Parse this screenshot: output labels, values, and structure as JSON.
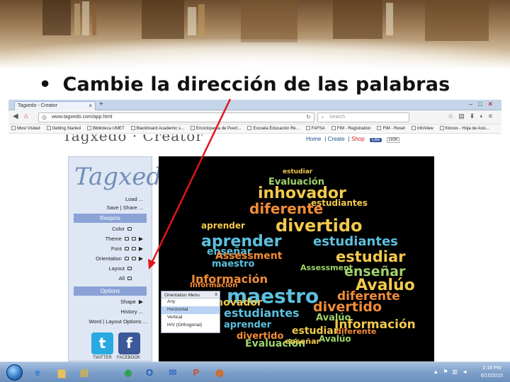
{
  "slide": {
    "bullet": "•",
    "title": "Cambie la dirección de las palabras"
  },
  "browser": {
    "tab_title": "Tagxedo - Creator",
    "new_tab": "+",
    "url": "www.tagxedo.com/app.html",
    "search_placeholder": "Search",
    "bookmarks": [
      "Most Visited",
      "Getting Started",
      "Biblioteca UMET",
      "Blackboard Academic s...",
      "Enciclopedia de Puert...",
      "Escuela Educación Re...",
      "FAFSA",
      "FIM - Registration",
      "FIM - Reset",
      "InfoView",
      "Klonos - Hoja de Asis..."
    ]
  },
  "site": {
    "title": "Tagxedo · Creator",
    "nav": [
      "Home",
      "Create",
      "Shop"
    ],
    "facebook_label": "Like",
    "facebook_count": "183K"
  },
  "panel": {
    "logo": "Tagxedo",
    "load": "Load ...",
    "save_share": "Save | Share ...",
    "respins_header": "Respins",
    "color": "Color",
    "theme": "Theme",
    "font": "Font",
    "orientation": "Orientation",
    "layout": "Layout",
    "all": "All",
    "options_header": "Options",
    "shape": "Shape",
    "history": "History ...",
    "word_layout_options": "Word | Layout Options ...",
    "twitter_label": "TWITTER",
    "facebook_label": "FACEBOOK",
    "twitter_glyph": "t",
    "facebook_glyph": "f"
  },
  "orientation_menu": {
    "title": "Orientation Menu",
    "close": "x",
    "options": [
      "Any",
      "Horizontal",
      "Vertical",
      "H/V (Orthogonal)"
    ],
    "selected": "Horizontal"
  },
  "cloud_words": [
    {
      "text": "estudiar",
      "color": "#f2c94c"
    },
    {
      "text": "Evaluación",
      "color": "#9fd36b"
    },
    {
      "text": "inhovador",
      "color": "#f2c94c"
    },
    {
      "text": "diferente",
      "color": "#f28c38"
    },
    {
      "text": "divertido",
      "color": "#f2c94c"
    },
    {
      "text": "aprender",
      "color": "#5bc0de"
    },
    {
      "text": "enseñar",
      "color": "#5bc0de"
    },
    {
      "text": "estudiantes",
      "color": "#5bc0de"
    },
    {
      "text": "estudiar",
      "color": "#f2c94c"
    },
    {
      "text": "Assessment",
      "color": "#f28c38"
    },
    {
      "text": "maestro",
      "color": "#5bc0de"
    },
    {
      "text": "enseñar",
      "color": "#9fd36b"
    },
    {
      "text": "Información",
      "color": "#f28c38"
    },
    {
      "text": "Avalúo",
      "color": "#f2c94c"
    },
    {
      "text": "maestro",
      "color": "#5bc0de"
    },
    {
      "text": "diferente",
      "color": "#f28c38"
    },
    {
      "text": "divertido",
      "color": "#f28c38"
    },
    {
      "text": "Inhovador",
      "color": "#f2c94c"
    },
    {
      "text": "estudiantes",
      "color": "#5bc0de"
    },
    {
      "text": "Avalúo",
      "color": "#9fd36b"
    },
    {
      "text": "Información",
      "color": "#f2c94c"
    },
    {
      "text": "aprender",
      "color": "#5bc0de"
    },
    {
      "text": "estudiar",
      "color": "#f2c94c"
    },
    {
      "text": "divertido",
      "color": "#f28c38"
    },
    {
      "text": "Evaluación",
      "color": "#9fd36b"
    },
    {
      "text": "enseñar",
      "color": "#f2c94c"
    },
    {
      "text": "Avalúo",
      "color": "#9fd36b"
    },
    {
      "text": "diferente",
      "color": "#f28c38"
    },
    {
      "text": "Información",
      "color": "#f28c38"
    },
    {
      "text": "aprender",
      "color": "#f2c94c"
    },
    {
      "text": "estudiantes",
      "color": "#f2c94c"
    },
    {
      "text": "Assessment",
      "color": "#9fd36b"
    },
    {
      "text": "divertido",
      "color": "#f28c38"
    }
  ],
  "taskbar": {
    "apps": [
      {
        "icon": "ie-icon",
        "glyph": "e",
        "color": "#2b7cd3"
      },
      {
        "icon": "folder-icon",
        "glyph": "▆",
        "color": "#e8c15a"
      },
      {
        "icon": "explorer-icon",
        "glyph": "▤",
        "color": "#d8b24a"
      },
      {
        "icon": "chrome-icon",
        "glyph": "◉",
        "color": "#2e9e46"
      },
      {
        "icon": "outlook-icon",
        "glyph": "O",
        "color": "#1d5fb8"
      },
      {
        "icon": "mail-icon",
        "glyph": "✉",
        "color": "#3a6fc2"
      },
      {
        "icon": "powerpoint-icon",
        "glyph": "P",
        "color": "#d24726"
      },
      {
        "icon": "firefox-icon",
        "glyph": "◍",
        "color": "#e66000"
      }
    ],
    "time": "2:18 PM",
    "date": "6/15/2015"
  }
}
